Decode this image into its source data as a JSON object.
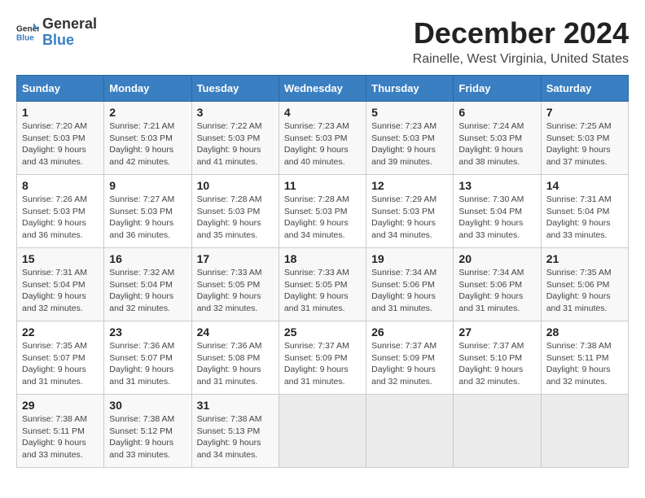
{
  "logo": {
    "line1": "General",
    "line2": "Blue"
  },
  "title": {
    "month": "December 2024",
    "location": "Rainelle, West Virginia, United States"
  },
  "headers": [
    "Sunday",
    "Monday",
    "Tuesday",
    "Wednesday",
    "Thursday",
    "Friday",
    "Saturday"
  ],
  "weeks": [
    [
      {
        "day": "1",
        "sunrise": "7:20 AM",
        "sunset": "5:03 PM",
        "daylight": "9 hours and 43 minutes."
      },
      {
        "day": "2",
        "sunrise": "7:21 AM",
        "sunset": "5:03 PM",
        "daylight": "9 hours and 42 minutes."
      },
      {
        "day": "3",
        "sunrise": "7:22 AM",
        "sunset": "5:03 PM",
        "daylight": "9 hours and 41 minutes."
      },
      {
        "day": "4",
        "sunrise": "7:23 AM",
        "sunset": "5:03 PM",
        "daylight": "9 hours and 40 minutes."
      },
      {
        "day": "5",
        "sunrise": "7:23 AM",
        "sunset": "5:03 PM",
        "daylight": "9 hours and 39 minutes."
      },
      {
        "day": "6",
        "sunrise": "7:24 AM",
        "sunset": "5:03 PM",
        "daylight": "9 hours and 38 minutes."
      },
      {
        "day": "7",
        "sunrise": "7:25 AM",
        "sunset": "5:03 PM",
        "daylight": "9 hours and 37 minutes."
      }
    ],
    [
      {
        "day": "8",
        "sunrise": "7:26 AM",
        "sunset": "5:03 PM",
        "daylight": "9 hours and 36 minutes."
      },
      {
        "day": "9",
        "sunrise": "7:27 AM",
        "sunset": "5:03 PM",
        "daylight": "9 hours and 36 minutes."
      },
      {
        "day": "10",
        "sunrise": "7:28 AM",
        "sunset": "5:03 PM",
        "daylight": "9 hours and 35 minutes."
      },
      {
        "day": "11",
        "sunrise": "7:28 AM",
        "sunset": "5:03 PM",
        "daylight": "9 hours and 34 minutes."
      },
      {
        "day": "12",
        "sunrise": "7:29 AM",
        "sunset": "5:03 PM",
        "daylight": "9 hours and 34 minutes."
      },
      {
        "day": "13",
        "sunrise": "7:30 AM",
        "sunset": "5:04 PM",
        "daylight": "9 hours and 33 minutes."
      },
      {
        "day": "14",
        "sunrise": "7:31 AM",
        "sunset": "5:04 PM",
        "daylight": "9 hours and 33 minutes."
      }
    ],
    [
      {
        "day": "15",
        "sunrise": "7:31 AM",
        "sunset": "5:04 PM",
        "daylight": "9 hours and 32 minutes."
      },
      {
        "day": "16",
        "sunrise": "7:32 AM",
        "sunset": "5:04 PM",
        "daylight": "9 hours and 32 minutes."
      },
      {
        "day": "17",
        "sunrise": "7:33 AM",
        "sunset": "5:05 PM",
        "daylight": "9 hours and 32 minutes."
      },
      {
        "day": "18",
        "sunrise": "7:33 AM",
        "sunset": "5:05 PM",
        "daylight": "9 hours and 31 minutes."
      },
      {
        "day": "19",
        "sunrise": "7:34 AM",
        "sunset": "5:06 PM",
        "daylight": "9 hours and 31 minutes."
      },
      {
        "day": "20",
        "sunrise": "7:34 AM",
        "sunset": "5:06 PM",
        "daylight": "9 hours and 31 minutes."
      },
      {
        "day": "21",
        "sunrise": "7:35 AM",
        "sunset": "5:06 PM",
        "daylight": "9 hours and 31 minutes."
      }
    ],
    [
      {
        "day": "22",
        "sunrise": "7:35 AM",
        "sunset": "5:07 PM",
        "daylight": "9 hours and 31 minutes."
      },
      {
        "day": "23",
        "sunrise": "7:36 AM",
        "sunset": "5:07 PM",
        "daylight": "9 hours and 31 minutes."
      },
      {
        "day": "24",
        "sunrise": "7:36 AM",
        "sunset": "5:08 PM",
        "daylight": "9 hours and 31 minutes."
      },
      {
        "day": "25",
        "sunrise": "7:37 AM",
        "sunset": "5:09 PM",
        "daylight": "9 hours and 31 minutes."
      },
      {
        "day": "26",
        "sunrise": "7:37 AM",
        "sunset": "5:09 PM",
        "daylight": "9 hours and 32 minutes."
      },
      {
        "day": "27",
        "sunrise": "7:37 AM",
        "sunset": "5:10 PM",
        "daylight": "9 hours and 32 minutes."
      },
      {
        "day": "28",
        "sunrise": "7:38 AM",
        "sunset": "5:11 PM",
        "daylight": "9 hours and 32 minutes."
      }
    ],
    [
      {
        "day": "29",
        "sunrise": "7:38 AM",
        "sunset": "5:11 PM",
        "daylight": "9 hours and 33 minutes."
      },
      {
        "day": "30",
        "sunrise": "7:38 AM",
        "sunset": "5:12 PM",
        "daylight": "9 hours and 33 minutes."
      },
      {
        "day": "31",
        "sunrise": "7:38 AM",
        "sunset": "5:13 PM",
        "daylight": "9 hours and 34 minutes."
      },
      null,
      null,
      null,
      null
    ]
  ],
  "labels": {
    "sunrise": "Sunrise:",
    "sunset": "Sunset:",
    "daylight": "Daylight:"
  }
}
